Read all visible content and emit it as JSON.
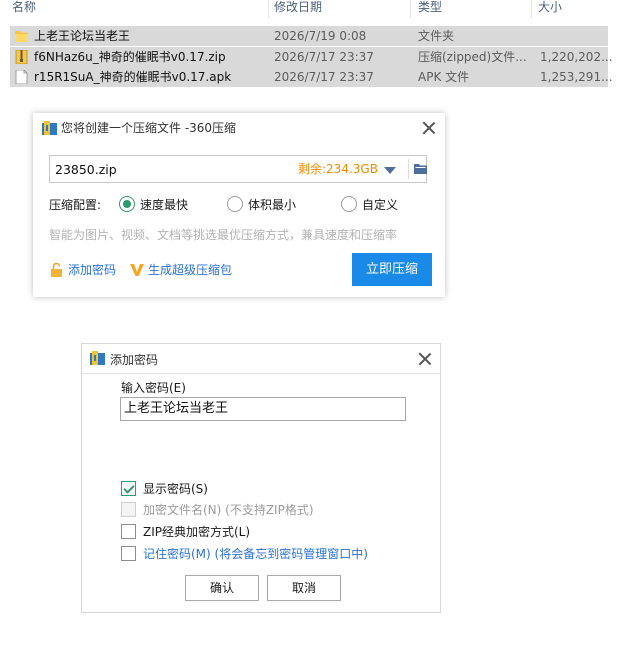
{
  "explorer": {
    "columns": {
      "name": "名称",
      "date": "修改日期",
      "type": "类型",
      "size": "大小"
    },
    "rows": [
      {
        "name": "上老王论坛当老王",
        "date": "2026/7/19 0:08",
        "type": "文件夹",
        "size": "",
        "icon": "folder-icon"
      },
      {
        "name": "f6NHaz6u_神奇的催眠书v0.17.zip",
        "date": "2026/7/17 23:37",
        "type": "压缩(zipped)文件...",
        "size": "1,220,202...",
        "icon": "zip-file-icon"
      },
      {
        "name": "r15R1SuA_神奇的催眠书v0.17.apk",
        "date": "2026/7/17 23:37",
        "type": "APK 文件",
        "size": "1,253,291...",
        "icon": "apk-file-icon"
      }
    ]
  },
  "compress_dialog": {
    "title": "您将创建一个压缩文件 -360压缩",
    "filename": "23850.zip",
    "remaining": "剩余:234.3GB",
    "config_label": "压缩配置:",
    "options": [
      {
        "label": "速度最快",
        "selected": true
      },
      {
        "label": "体积最小",
        "selected": false
      },
      {
        "label": "自定义",
        "selected": false
      }
    ],
    "hint": "智能为图片、视频、文档等挑选最优压缩方式，兼具速度和压缩率",
    "add_password": "添加密码",
    "super_compress": "生成超级压缩包",
    "compress_now": "立即压缩",
    "accent_color": "#1a8ae8"
  },
  "password_dialog": {
    "title": "添加密码",
    "enter_label": "输入密码(E)",
    "password_value": "上老王论坛当老王",
    "show_password": "显示密码(S)",
    "encrypt_filename": "加密文件名(N) (不支持ZIP格式)",
    "zip_classic": "ZIP经典加密方式(L)",
    "remember_password": "记住密码(M) (将会备忘到密码管理窗口中)",
    "ok": "确认",
    "cancel": "取消"
  }
}
